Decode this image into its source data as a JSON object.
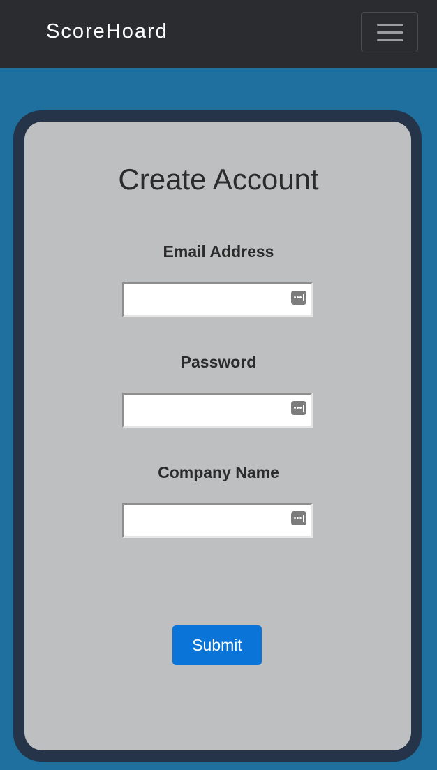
{
  "navbar": {
    "brand": "ScoreHoard",
    "menu_icon": "hamburger-menu-icon"
  },
  "form": {
    "title": "Create Account",
    "fields": [
      {
        "label": "Email Address",
        "value": "",
        "icon": "password-manager-key-icon"
      },
      {
        "label": "Password",
        "value": "",
        "icon": "password-manager-key-icon"
      },
      {
        "label": "Company Name",
        "value": "",
        "icon": "password-manager-key-icon"
      }
    ],
    "submit_label": "Submit"
  },
  "colors": {
    "navbar_bg": "#2a2c2f",
    "page_bg": "#1f6f9f",
    "frame": "#26344a",
    "card_bg": "#bebfc1",
    "submit_bg": "#0a74d8"
  }
}
